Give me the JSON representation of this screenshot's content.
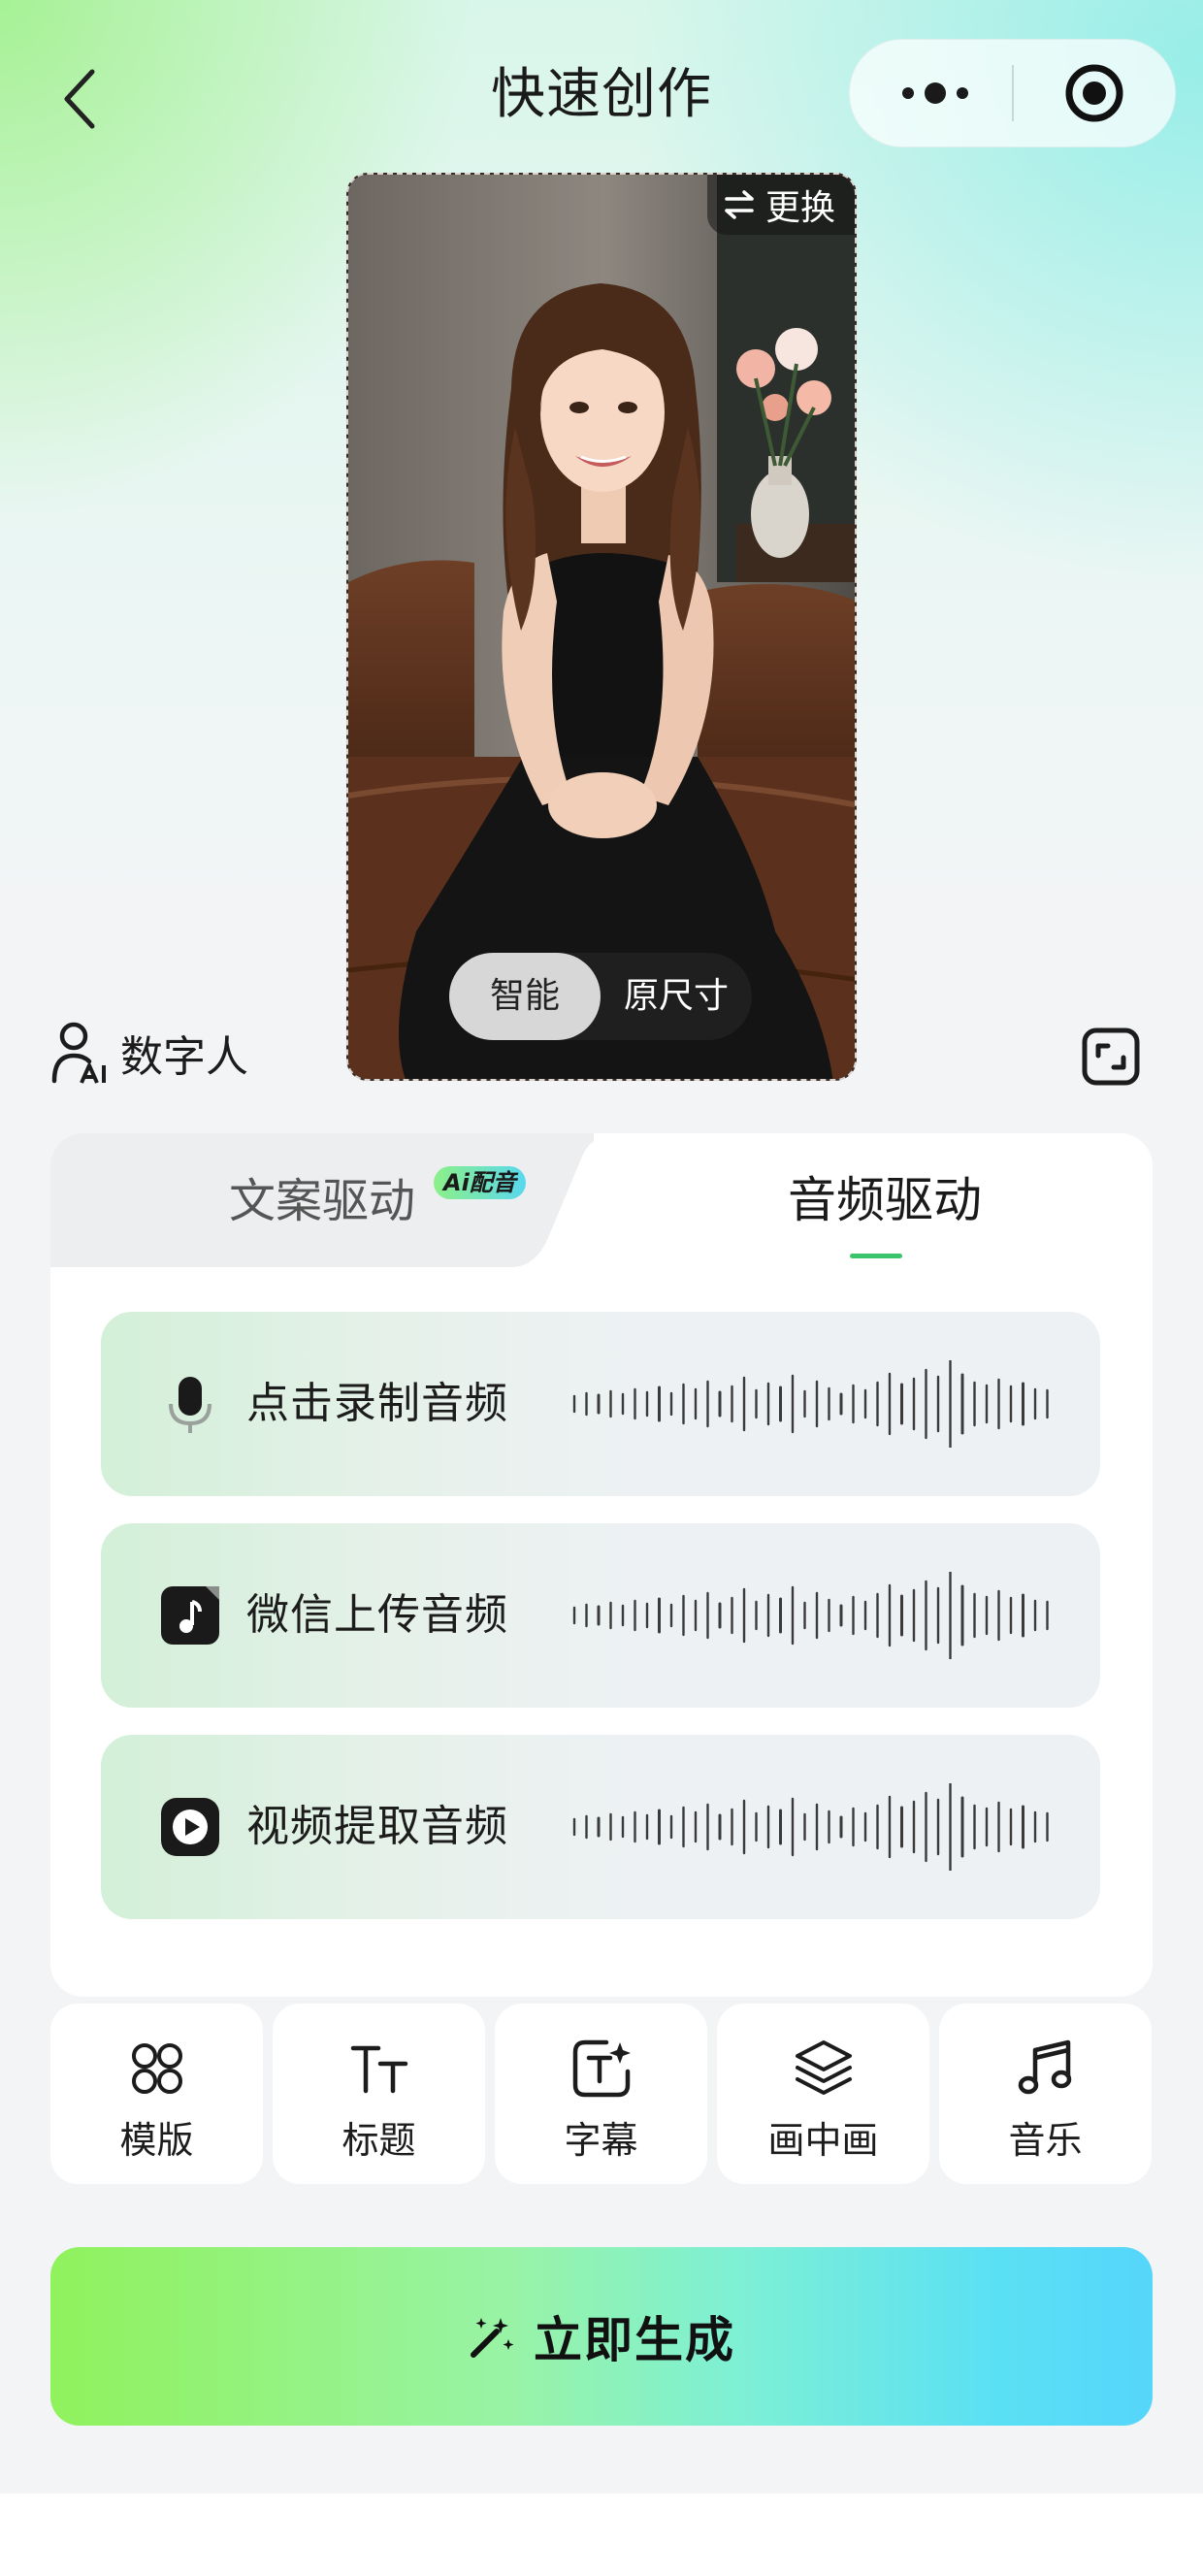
{
  "header": {
    "title": "快速创作",
    "back_icon": "chevron-left-icon",
    "more_icon": "more-dots-icon",
    "target_icon": "target-icon"
  },
  "avatar_card": {
    "swap_label": "更换",
    "swap_icon": "swap-arrows-icon",
    "ratio_options": [
      "智能",
      "原尺寸"
    ],
    "ratio_selected": "智能"
  },
  "digital_human": {
    "label": "数字人",
    "icon": "ai-person-icon",
    "expand_icon": "expand-icon"
  },
  "tabs": {
    "left_label": "文案驱动",
    "left_badge": "Ai配音",
    "right_label": "音频驱动",
    "selected": "音频驱动",
    "accent_color": "#3bc46b"
  },
  "audio_options": [
    {
      "label": "点击录制音频",
      "icon": "microphone-icon"
    },
    {
      "label": "微信上传音频",
      "icon": "music-file-icon"
    },
    {
      "label": "视频提取音频",
      "icon": "play-icon"
    }
  ],
  "tools": [
    {
      "label": "模版",
      "icon": "template-grid-icon"
    },
    {
      "label": "标题",
      "icon": "text-size-icon"
    },
    {
      "label": "字幕",
      "icon": "subtitle-icon"
    },
    {
      "label": "画中画",
      "icon": "layers-icon"
    },
    {
      "label": "音乐",
      "icon": "music-note-icon"
    }
  ],
  "generate": {
    "label": "立即生成",
    "icon": "magic-wand-icon"
  }
}
